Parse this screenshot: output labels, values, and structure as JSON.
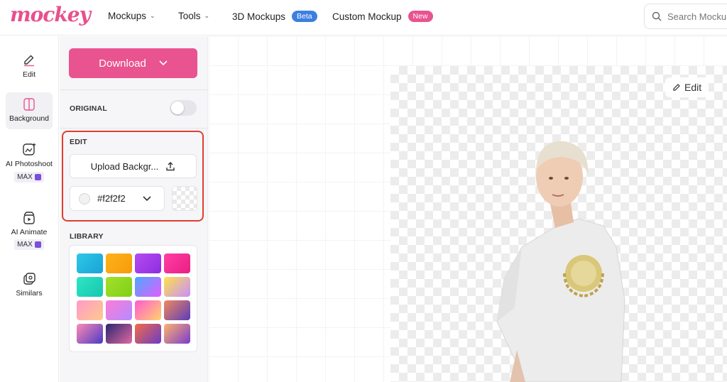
{
  "brand": {
    "logo_text": "mockey",
    "accent": "#e9538f"
  },
  "nav": {
    "mockups": "Mockups",
    "tools": "Tools",
    "mockups_3d": "3D Mockups",
    "beta_badge": "Beta",
    "custom_mockup": "Custom Mockup",
    "new_badge": "New",
    "beta_color": "#3d7fe0",
    "new_color": "#e9538f"
  },
  "search": {
    "placeholder": "Search Mockup"
  },
  "rail": {
    "items": [
      {
        "label": "Edit",
        "icon": "pencil-icon"
      },
      {
        "label": "Background",
        "icon": "background-icon",
        "active": true
      },
      {
        "label": "AI Photoshoot",
        "icon": "ai-photoshoot-icon",
        "badge": "MAX"
      },
      {
        "label": "AI Animate",
        "icon": "ai-animate-icon",
        "badge": "MAX"
      },
      {
        "label": "Similars",
        "icon": "similars-icon"
      }
    ]
  },
  "panel": {
    "download_label": "Download",
    "original_label": "ORIGINAL",
    "original_on": false,
    "edit_label": "EDIT",
    "upload_label": "Upload Backgr...",
    "color_value": "#f2f2f2",
    "library_label": "LIBRARY"
  },
  "library_tiles": [
    {
      "name": "cyan-glitter",
      "colors": [
        "#2ec7e8",
        "#1aa3d6"
      ]
    },
    {
      "name": "orange-glitter",
      "colors": [
        "#ffb21a",
        "#f59b0b"
      ]
    },
    {
      "name": "purple-glitter",
      "colors": [
        "#b44cf0",
        "#8e2de0"
      ]
    },
    {
      "name": "pink-glitter",
      "colors": [
        "#ff3fa4",
        "#e91e84"
      ]
    },
    {
      "name": "teal-glitter",
      "colors": [
        "#2ee6c4",
        "#16c6b0"
      ]
    },
    {
      "name": "lime-glitter",
      "colors": [
        "#a4e02a",
        "#7fcf18"
      ]
    },
    {
      "name": "violet-gradient",
      "colors": [
        "#4aa8ff",
        "#e45cff"
      ]
    },
    {
      "name": "yellow-blur",
      "colors": [
        "#ffe14a",
        "#c78dff"
      ]
    },
    {
      "name": "peach-blur",
      "colors": [
        "#ff9ac8",
        "#ffc98d"
      ]
    },
    {
      "name": "pink-blur",
      "colors": [
        "#ff7bd7",
        "#b28cff"
      ]
    },
    {
      "name": "magenta-blur",
      "colors": [
        "#ff5ad2",
        "#ffd46b"
      ]
    },
    {
      "name": "fluid-dark",
      "colors": [
        "#f08a5d",
        "#5b3bbd"
      ]
    },
    {
      "name": "fluid-purple",
      "colors": [
        "#ff8ab4",
        "#4a3ac7"
      ]
    },
    {
      "name": "fluid-navy",
      "colors": [
        "#2b2670",
        "#e06aa2"
      ]
    },
    {
      "name": "fluid-sunset",
      "colors": [
        "#f46b45",
        "#6a3cc8"
      ]
    },
    {
      "name": "fluid-orange",
      "colors": [
        "#ffb36b",
        "#7a3bd0"
      ]
    }
  ],
  "canvas": {
    "edit_label": "Edit"
  }
}
